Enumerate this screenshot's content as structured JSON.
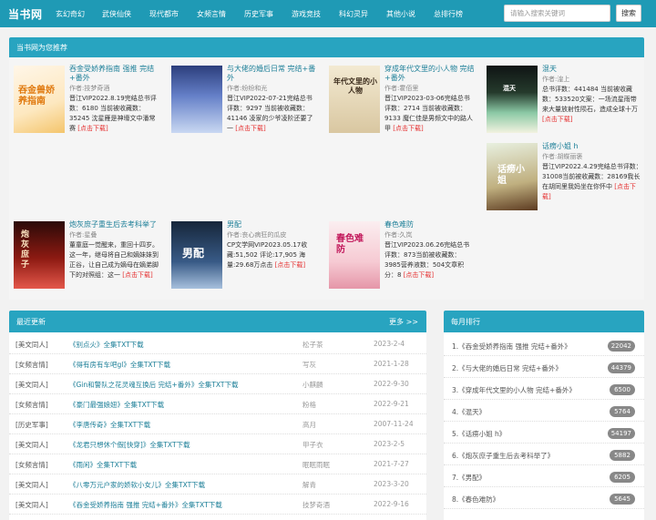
{
  "header": {
    "logo": "当书网",
    "nav": [
      "玄幻奇幻",
      "武侠仙侠",
      "现代都市",
      "女频言情",
      "历史军事",
      "游戏竞技",
      "科幻灵异",
      "其他小说",
      "总排行榜"
    ],
    "search_placeholder": "请输入搜索关键词",
    "search_button": "搜索"
  },
  "recommend": {
    "title": "当书网为您推荐",
    "more": "[点击下载]",
    "items": [
      {
        "title": "吞金受娇养指南 强推 完结+番外",
        "author": "作者:技梦奇酒",
        "desc": "晋江VIP2022.8.19完结总书评数：6180 当前被收藏数：35245 沈星雁是神壕文中潘常赛",
        "cover_text": "吞金兽娇养指南"
      },
      {
        "title": "与大佬的婚后日常 完结+番外",
        "author": "作者:纷纷和光",
        "desc": "晋江VIP2022-07-21完结总书评数：9297 当前被收藏数：41146 凌家的少爷凌阶还要了一",
        "cover_text": ""
      },
      {
        "title": "穿成年代文里的小人物 完结+番外",
        "author": "作者:霍佰里",
        "desc": "晋江VIP2023-03-06完结总书评数：2714 当前被收藏数：9133 魔仁佳是男频文中的路人甲",
        "cover_text": "年代文里的小人物"
      },
      {
        "title": "混天",
        "author": "作者:湟上",
        "desc": "总书评数：441484 当前被收藏数：533520文案：一场流星雨带来大量放射性陨石，造成全球十万",
        "cover_text": "混天"
      },
      {
        "title": "话痨小姐 h",
        "author": "作者:胡蝶丽褒",
        "desc": "晋江VIP2022.4.29完结总书评数：31008当前被收藏数：28169我长在胡同里我妈坐在你怀中",
        "cover_text": "话痨小姐"
      },
      {
        "title": "炮灰庶子重生后去考科举了",
        "author": "作者:星叠",
        "desc": "董童庭一觉醒来，重回十四岁。这一年，继母将自己和嫡妹妹到正谷，让自己成为嫡母在嫡弟脚下的对照组：这一",
        "cover_text": "炮灰庶子"
      },
      {
        "title": "男配",
        "author": "作者:丧心病狂的瓜皮",
        "desc": "CP文学网VIP2023.05.17收藏:51,502 评论:17,905 海量:29.68万点击",
        "cover_text": "男配"
      },
      {
        "title": "春色难防",
        "author": "作者:久岚",
        "desc": "晋江VIP2023.06.26完结总书评数：873当前被收藏数：3985营养液数：504文章积分：8",
        "cover_text": "春色难防"
      }
    ]
  },
  "latest": {
    "title": "最近更新",
    "more": "更多 >>",
    "rows": [
      {
        "cat": "[美文同人]",
        "title": "《别点火》全集TXT下载",
        "author": "松子茶",
        "date": "2023-2-4"
      },
      {
        "cat": "[女频言情]",
        "title": "《得有房有车吧gl》全集TXT下载",
        "author": "写灰",
        "date": "2021-1-28"
      },
      {
        "cat": "[美文同人]",
        "title": "《Gin和警队之花灵魂互换后 完结+番外》全集TXT下载",
        "author": "小麒麟",
        "date": "2022-9-30"
      },
      {
        "cat": "[女频言情]",
        "title": "《豪门最强娘妞》全集TXT下载",
        "author": "粉格",
        "date": "2022-9-21"
      },
      {
        "cat": "[历史军事]",
        "title": "《李唐传奇》全集TXT下载",
        "author": "高月",
        "date": "2007-11-24"
      },
      {
        "cat": "[美文同人]",
        "title": "《龙君只想休个假[快穿]》全集TXT下载",
        "author": "甲子衣",
        "date": "2023-2-5"
      },
      {
        "cat": "[女频言情]",
        "title": "《雨闲》全集TXT下载",
        "author": "眠眠雨眠",
        "date": "2021-7-27"
      },
      {
        "cat": "[美文同人]",
        "title": "《八零万元户家的娇软小女儿》全集TXT下载",
        "author": "解青",
        "date": "2023-3-20"
      },
      {
        "cat": "[美文同人]",
        "title": "《吞金受娇养指南 强推 完结+番外》全集TXT下载",
        "author": "技梦奇酒",
        "date": "2022-9-16"
      }
    ]
  },
  "rank": {
    "title": "每月排行",
    "rows": [
      {
        "label": "1.《吞金受娇养指南 强推 完结+番外》",
        "count": "22042"
      },
      {
        "label": "2.《与大佬的婚后日常 完结+番外》",
        "count": "44379"
      },
      {
        "label": "3.《穿成年代文里的小人物 完结+番外》",
        "count": "6500"
      },
      {
        "label": "4.《混天》",
        "count": "5764"
      },
      {
        "label": "5.《话痨小姐 h》",
        "count": "54197"
      },
      {
        "label": "6.《炮灰庶子重生后去考科举了》",
        "count": "5882"
      },
      {
        "label": "7.《男配》",
        "count": "6205"
      },
      {
        "label": "8.《春色难防》",
        "count": "5645"
      }
    ]
  },
  "colors": {
    "header": "#1f9ab5",
    "panel_head": "#28a4c0",
    "link": "#1b7e97",
    "more": "#e53030"
  }
}
